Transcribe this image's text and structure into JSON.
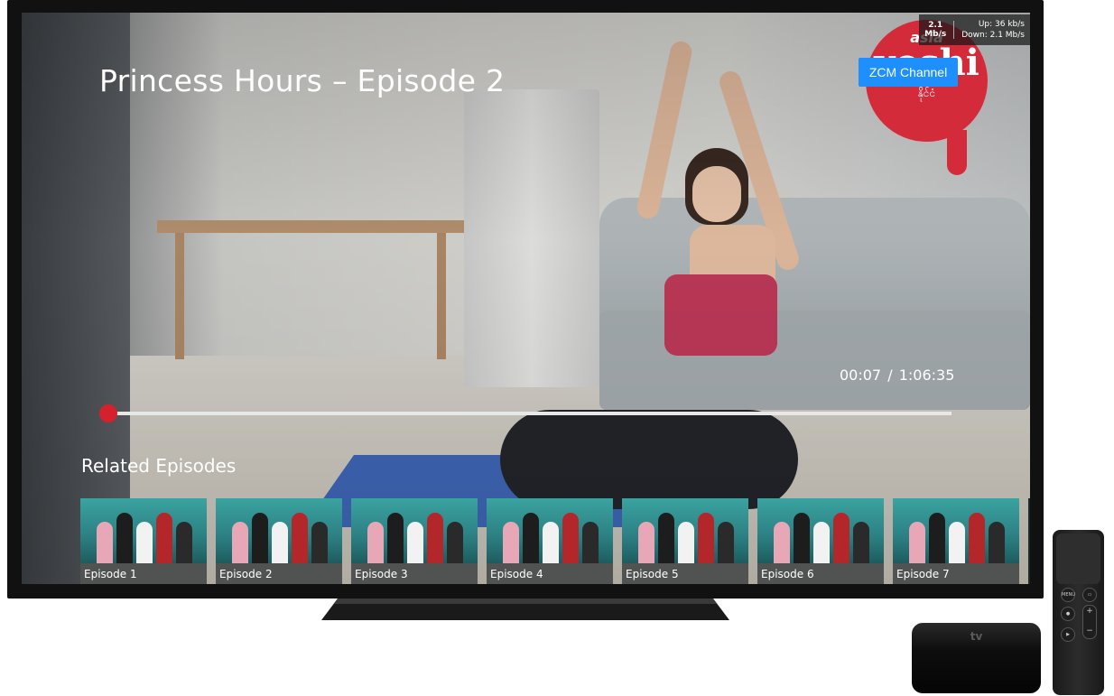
{
  "video": {
    "title": "Princess Hours – Episode 2",
    "channel_label": "ZCM Channel",
    "current_time": "00:07",
    "separator": "/",
    "duration": "1:06:35",
    "progress_fraction": 0.002
  },
  "stats": {
    "speed_value": "2.1",
    "speed_unit": "Mb/s",
    "up": "Up: 36 kb/s",
    "down": "Down: 2.1 Mb/s"
  },
  "logo": {
    "line1": "asia",
    "line2": "yoshi",
    "line3": "နိုင်ငံ"
  },
  "related": {
    "heading": "Related Episodes",
    "episodes": [
      {
        "label": "Episode 1"
      },
      {
        "label": "Episode 2"
      },
      {
        "label": "Episode 3"
      },
      {
        "label": "Episode 4"
      },
      {
        "label": "Episode 5"
      },
      {
        "label": "Episode 6"
      },
      {
        "label": "Episode 7"
      }
    ]
  },
  "device": {
    "box_logo": " tv",
    "remote_menu": "MENU",
    "remote_vol_up": "+",
    "remote_vol_down": "−"
  },
  "colors": {
    "accent_blue": "#1e8fff",
    "progress_red": "#d5202e"
  }
}
